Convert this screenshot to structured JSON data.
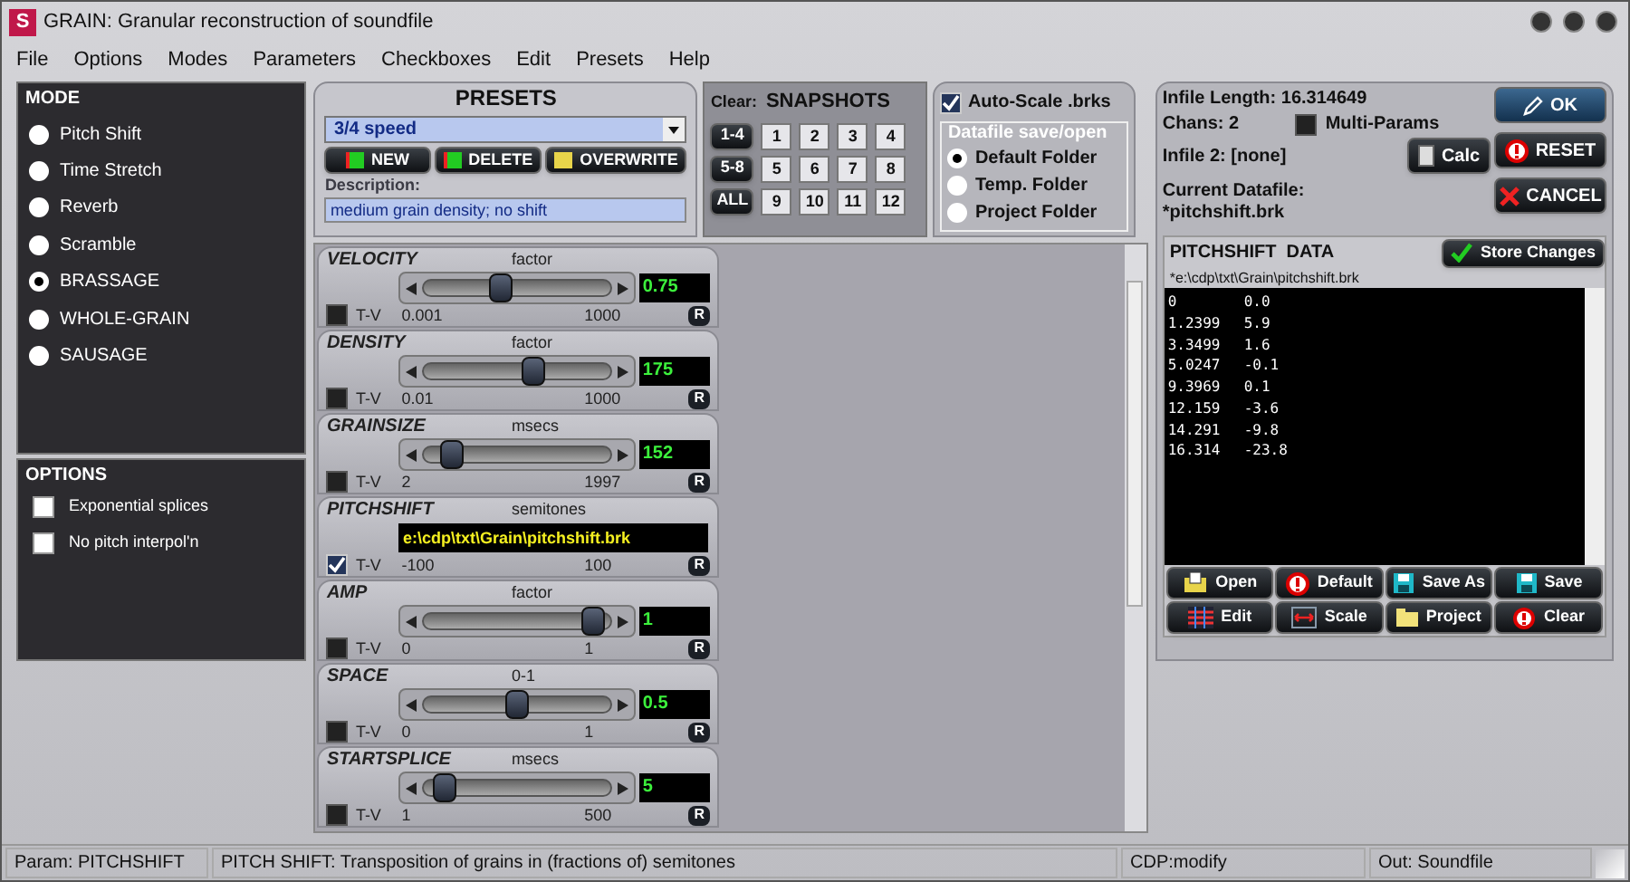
{
  "window": {
    "title": "GRAIN: Granular reconstruction of soundfile",
    "app_icon": "S"
  },
  "menu": [
    "File",
    "Options",
    "Modes",
    "Parameters",
    "Checkboxes",
    "Edit",
    "Presets",
    "Help"
  ],
  "mode": {
    "title": "MODE",
    "items": [
      {
        "label": "Pitch Shift",
        "selected": false
      },
      {
        "label": "Time Stretch",
        "selected": false
      },
      {
        "label": "Reverb",
        "selected": false
      },
      {
        "label": "Scramble",
        "selected": false
      },
      {
        "label": "BRASSAGE",
        "selected": true
      },
      {
        "label": "WHOLE-GRAIN",
        "selected": false
      },
      {
        "label": "SAUSAGE",
        "selected": false
      }
    ]
  },
  "options": {
    "title": "OPTIONS",
    "items": [
      {
        "label": "Exponential splices",
        "checked": false
      },
      {
        "label": "No pitch interpol'n",
        "checked": false
      }
    ]
  },
  "presets": {
    "title": "PRESETS",
    "selected": "3/4 speed",
    "buttons": [
      "NEW",
      "DELETE",
      "OVERWRITE"
    ],
    "description_label": "Description:",
    "description": "medium grain density; no shift"
  },
  "snapshots": {
    "clear_label": "Clear:",
    "title": "SNAPSHOTS",
    "clear_buttons": [
      "1-4",
      "5-8",
      "ALL"
    ],
    "slots": [
      "1",
      "2",
      "3",
      "4",
      "5",
      "6",
      "7",
      "8",
      "9",
      "10",
      "11",
      "12"
    ]
  },
  "autoscale": {
    "label": "Auto-Scale .brks",
    "checked": true
  },
  "datafile_save": {
    "title": "Datafile save/open",
    "items": [
      {
        "label": "Default Folder",
        "selected": true
      },
      {
        "label": "Temp. Folder",
        "selected": false
      },
      {
        "label": "Project Folder",
        "selected": false
      }
    ]
  },
  "params": [
    {
      "kind": "slider",
      "name": "VELOCITY",
      "unit": "factor",
      "level": 0.4,
      "value": "0.75",
      "tv": false,
      "tv_label": "T-V",
      "min": "0.001",
      "max": "1000",
      "reset": "R"
    },
    {
      "kind": "slider",
      "name": "DENSITY",
      "unit": "factor",
      "level": 0.6,
      "value": "175",
      "tv": false,
      "tv_label": "T-V",
      "min": "0.01",
      "max": "1000",
      "reset": "R"
    },
    {
      "kind": "slider",
      "name": "GRAINSIZE",
      "unit": "msecs",
      "level": 0.1,
      "value": "152",
      "tv": false,
      "tv_label": "T-V",
      "min": "2",
      "max": "1997",
      "reset": "R"
    },
    {
      "kind": "file",
      "name": "PITCHSHIFT",
      "unit": "semitones",
      "value": "e:\\cdp\\txt\\Grain\\pitchshift.brk",
      "tv": true,
      "tv_label": "T-V",
      "min": "-100",
      "max": "100",
      "reset": "R"
    },
    {
      "kind": "slider",
      "name": "AMP",
      "unit": "factor",
      "level": 0.97,
      "value": "1",
      "tv": false,
      "tv_label": "T-V",
      "min": "0",
      "max": "1",
      "reset": "R"
    },
    {
      "kind": "slider",
      "name": "SPACE",
      "unit": "0-1",
      "level": 0.5,
      "value": "0.5",
      "tv": false,
      "tv_label": "T-V",
      "min": "0",
      "max": "1",
      "reset": "R"
    },
    {
      "kind": "slider",
      "name": "STARTSPLICE",
      "unit": "msecs",
      "level": 0.05,
      "value": "5",
      "tv": false,
      "tv_label": "T-V",
      "min": "1",
      "max": "500",
      "reset": "R"
    }
  ],
  "info": {
    "infile_length": "Infile Length: 16.314649",
    "chans": "Chans: 2",
    "infile2": "Infile 2: [none]",
    "multi_params": {
      "label": "Multi-Params",
      "checked": false
    },
    "current_label": "Current Datafile:",
    "current": "*pitchshift.brk"
  },
  "actions": {
    "ok": "OK",
    "calc": "Calc",
    "reset": "RESET",
    "cancel": "CANCEL"
  },
  "data": {
    "title": "PITCHSHIFT  DATA",
    "store": "Store Changes",
    "path": "*e:\\cdp\\txt\\Grain\\pitchshift.brk",
    "rows": [
      [
        "0",
        "0.0"
      ],
      [
        "1.2399",
        "5.9"
      ],
      [
        "3.3499",
        "1.6"
      ],
      [
        "5.0247",
        "-0.1"
      ],
      [
        "9.3969",
        "0.1"
      ],
      [
        "12.159",
        "-3.6"
      ],
      [
        "14.291",
        "-9.8"
      ],
      [
        "16.314",
        "-23.8"
      ]
    ]
  },
  "file_buttons": [
    {
      "kind": "open",
      "label": "Open"
    },
    {
      "kind": "default",
      "label": "Default"
    },
    {
      "kind": "save",
      "label": "Save As"
    },
    {
      "kind": "save",
      "label": "Save"
    },
    {
      "kind": "edit",
      "label": "Edit"
    },
    {
      "kind": "scale",
      "label": "Scale"
    },
    {
      "kind": "folder",
      "label": "Project"
    },
    {
      "kind": "clear",
      "label": "Clear"
    }
  ],
  "status_bar": [
    "Param: PITCHSHIFT",
    "PITCH SHIFT: Transposition of grains in (fractions of) semitones",
    "CDP:modify",
    "Out: Soundfile"
  ]
}
